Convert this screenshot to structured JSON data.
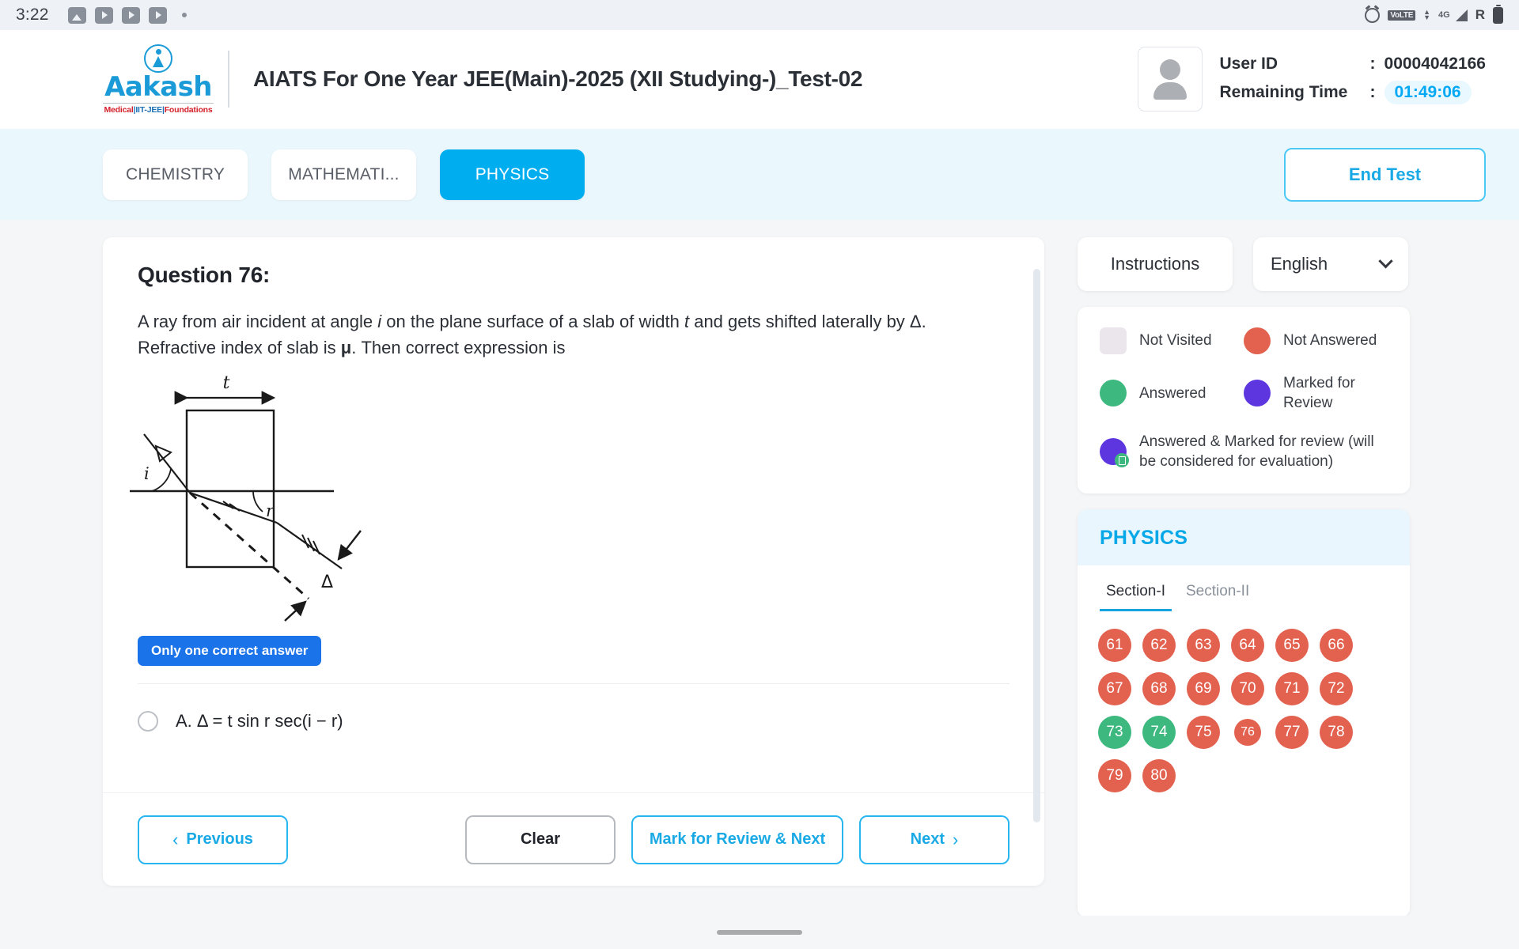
{
  "statusbar": {
    "time": "3:22",
    "left_icons": [
      "gallery-icon",
      "play-icon",
      "play-icon",
      "play-icon",
      "dot-icon"
    ],
    "right_icons": [
      "alarm-icon",
      "volte-icon",
      "signal-4g-icon",
      "roaming-icon",
      "battery-icon"
    ],
    "volte_label": "VoLTE",
    "network_label": "4G",
    "roaming_label": "R"
  },
  "header": {
    "logo_word": "Aakash",
    "logo_tag_1": "Medical",
    "logo_tag_sep": "|",
    "logo_tag_2": "IIT-JEE",
    "logo_tag_3": "Foundations",
    "title": "AIATS For One Year JEE(Main)-2025 (XII Studying-)_Test-02",
    "user_id_label": "User ID",
    "user_id_value": "00004042166",
    "remaining_time_label": "Remaining Time",
    "remaining_time_value": "01:49:06",
    "colon": ":"
  },
  "tabs": {
    "items": [
      {
        "label": "CHEMISTRY",
        "active": false
      },
      {
        "label": "MATHEMATI...",
        "active": false
      },
      {
        "label": "PHYSICS",
        "active": true
      }
    ],
    "end_test_label": "End Test"
  },
  "question": {
    "heading": "Question 76:",
    "body_parts": [
      {
        "text": "A ray from air incident at angle ",
        "style": "normal"
      },
      {
        "text": "i",
        "style": "italic"
      },
      {
        "text": " on the plane surface of a slab of width ",
        "style": "normal"
      },
      {
        "text": "t",
        "style": "italic"
      },
      {
        "text": " and gets shifted laterally by Δ. Refractive index of slab is ",
        "style": "normal"
      },
      {
        "text": "μ",
        "style": "bold"
      },
      {
        "text": ". Then correct expression is",
        "style": "normal"
      }
    ],
    "body_plain": "A ray from air incident at angle i on the plane surface of a slab of width t and gets shifted laterally by Δ. Refractive index of slab is μ. Then correct expression is",
    "diagram_labels": {
      "thickness": "t",
      "incident_angle": "i",
      "refraction_angle": "r",
      "shift": "Δ"
    },
    "badge": "Only one correct answer",
    "options": [
      {
        "key": "A.",
        "text": "Δ = t sin r sec(i − r)",
        "selected": false
      }
    ]
  },
  "footer": {
    "previous_label": "Previous",
    "clear_label": "Clear",
    "mark_review_label": "Mark for Review & Next",
    "next_label": "Next",
    "prev_chevron": "‹",
    "next_chevron": "›"
  },
  "right_panel": {
    "instructions_label": "Instructions",
    "language_value": "English",
    "legend": [
      {
        "type": "square",
        "color": "#EAE6EC",
        "label": "Not Visited"
      },
      {
        "type": "circle",
        "color": "#E2614F",
        "label": "Not Answered"
      },
      {
        "type": "circle",
        "color": "#3DB87F",
        "label": "Answered"
      },
      {
        "type": "circle",
        "color": "#5D36E0",
        "label": "Marked for Review"
      },
      {
        "type": "circle-badge",
        "color": "#5D36E0",
        "label": "Answered & Marked for review (will be considered for evaluation)"
      }
    ],
    "legend_labels": {
      "not_visited": "Not Visited",
      "not_answered": "Not Answered",
      "answered": "Answered",
      "marked_for_review": "Marked for Review",
      "answered_marked": "Answered & Marked for review (will be considered for evaluation)"
    },
    "subject": "PHYSICS",
    "sections": [
      {
        "label": "Section-I",
        "active": true
      },
      {
        "label": "Section-II",
        "active": false
      }
    ],
    "questions": [
      {
        "num": "61",
        "state": "notanswered",
        "current": false
      },
      {
        "num": "62",
        "state": "notanswered",
        "current": false
      },
      {
        "num": "63",
        "state": "notanswered",
        "current": false
      },
      {
        "num": "64",
        "state": "notanswered",
        "current": false
      },
      {
        "num": "65",
        "state": "notanswered",
        "current": false
      },
      {
        "num": "66",
        "state": "notanswered",
        "current": false
      },
      {
        "num": "67",
        "state": "notanswered",
        "current": false
      },
      {
        "num": "68",
        "state": "notanswered",
        "current": false
      },
      {
        "num": "69",
        "state": "notanswered",
        "current": false
      },
      {
        "num": "70",
        "state": "notanswered",
        "current": false
      },
      {
        "num": "71",
        "state": "notanswered",
        "current": false
      },
      {
        "num": "72",
        "state": "notanswered",
        "current": false
      },
      {
        "num": "73",
        "state": "answered",
        "current": false
      },
      {
        "num": "74",
        "state": "answered",
        "current": false
      },
      {
        "num": "75",
        "state": "notanswered",
        "current": false
      },
      {
        "num": "76",
        "state": "notanswered",
        "current": true
      },
      {
        "num": "77",
        "state": "notanswered",
        "current": false
      },
      {
        "num": "78",
        "state": "notanswered",
        "current": false
      },
      {
        "num": "79",
        "state": "notanswered",
        "current": false
      },
      {
        "num": "80",
        "state": "notanswered",
        "current": false
      }
    ]
  },
  "colors": {
    "accent_blue": "#00AEEF",
    "badge_blue": "#1A73E8",
    "not_answered": "#E2614F",
    "answered": "#3DB87F",
    "marked": "#5D36E0",
    "not_visited": "#EAE6EC",
    "tab_bg": "#EAF7FD"
  }
}
